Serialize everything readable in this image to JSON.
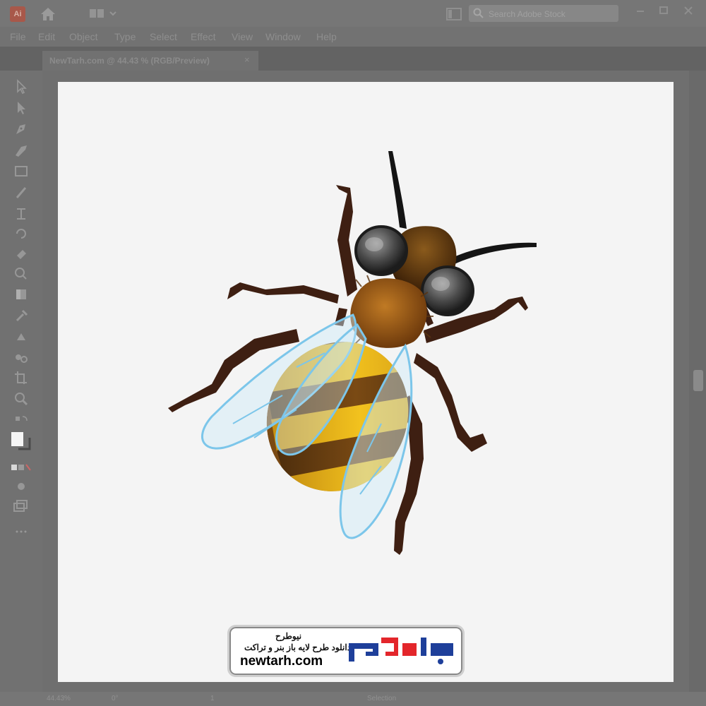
{
  "app": {
    "logo_text": "Ai"
  },
  "search": {
    "placeholder": "Search Adobe Stock"
  },
  "menu": [
    "File",
    "Edit",
    "Object",
    "Type",
    "Select",
    "Effect",
    "View",
    "Window",
    "Help"
  ],
  "document_tab": {
    "title": "NewTarh.com @ 44.43 % (RGB/Preview)",
    "close": "×"
  },
  "status": {
    "zoom": "44.43%",
    "rotation": "0°",
    "artboard": "1",
    "tool": "Selection"
  },
  "watermark": {
    "name_fa": "نیوطرح",
    "tagline_fa": "دانلود طرح لایه باز بنر و تراکت",
    "domain": "newtarh.com",
    "logo_colors": {
      "red": "#e3262b",
      "blue": "#1e3f9a"
    }
  },
  "colors": {
    "artboard": "#f4f4f4",
    "chrome": "#717171"
  }
}
